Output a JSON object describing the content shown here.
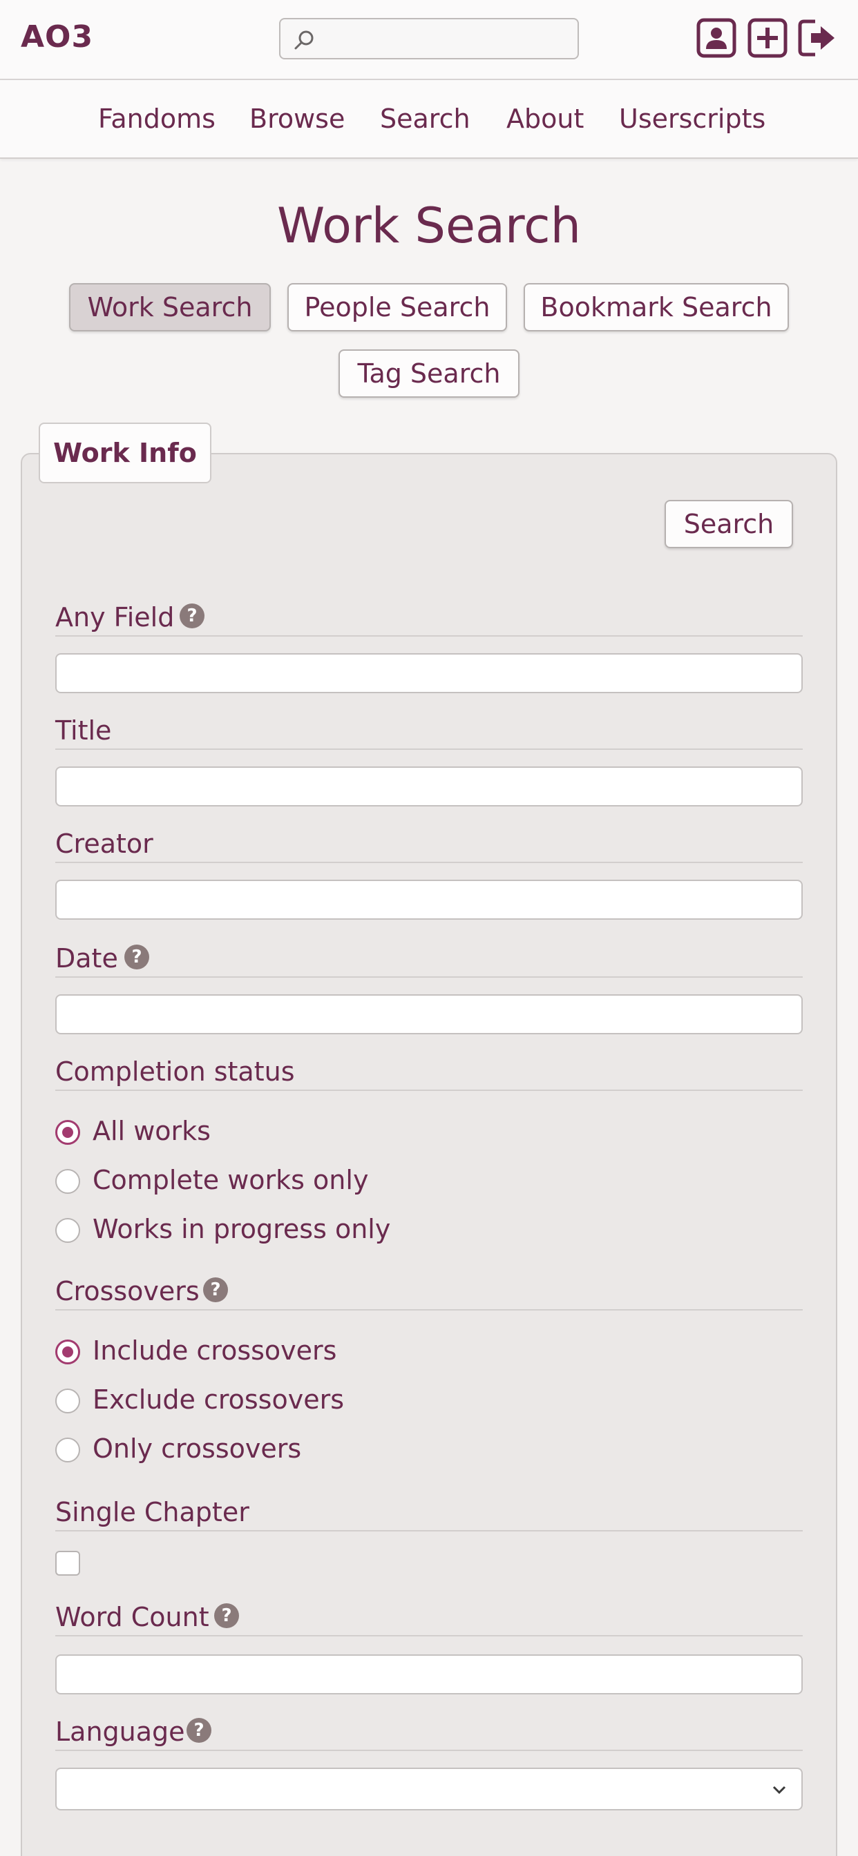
{
  "header": {
    "logo": "AO3",
    "search": {
      "value": "",
      "placeholder": ""
    },
    "icons": [
      "user-profile-icon",
      "post-new-icon",
      "logout-icon"
    ]
  },
  "nav": {
    "items": [
      {
        "label": "Fandoms"
      },
      {
        "label": "Browse"
      },
      {
        "label": "Search"
      },
      {
        "label": "About"
      },
      {
        "label": "Userscripts"
      }
    ]
  },
  "main": {
    "title": "Work Search",
    "tabs": [
      {
        "label": "Work Search",
        "active": true
      },
      {
        "label": "People Search",
        "active": false
      },
      {
        "label": "Bookmark Search",
        "active": false
      },
      {
        "label": "Tag Search",
        "active": false
      }
    ]
  },
  "form": {
    "legend": "Work Info",
    "search_label": "Search",
    "help_glyph": "?",
    "any_field": {
      "label": "Any Field",
      "value": ""
    },
    "title": {
      "label": "Title",
      "value": ""
    },
    "creator": {
      "label": "Creator",
      "value": ""
    },
    "date": {
      "label": "Date",
      "value": ""
    },
    "completion": {
      "label": "Completion status",
      "options": [
        "All works",
        "Complete works only",
        "Works in progress only"
      ],
      "selected": "All works"
    },
    "crossovers": {
      "label": "Crossovers",
      "options": [
        "Include crossovers",
        "Exclude crossovers",
        "Only crossovers"
      ],
      "selected": "Include crossovers"
    },
    "single_chapter": {
      "label": "Single Chapter",
      "checked": false
    },
    "word_count": {
      "label": "Word Count",
      "value": ""
    },
    "language": {
      "label": "Language",
      "value": ""
    }
  },
  "colors": {
    "accent": "#6a2a4e",
    "radio_checked": "#a23b6f",
    "background": "#f6f4f3",
    "fieldset_bg": "#ebe8e7"
  }
}
